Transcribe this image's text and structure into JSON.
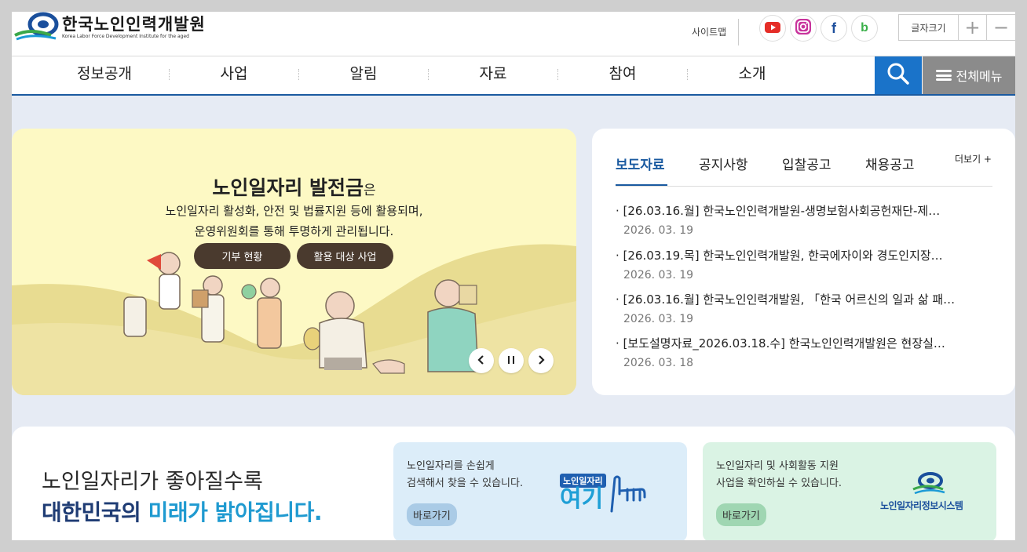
{
  "colors": {
    "primary": "#1a5aa0",
    "search_bg": "#1a73c9",
    "banner_bg": "#fdf9c4",
    "page_bg": "#e6ebf4"
  },
  "header": {
    "logo_title": "한국노인인력개발원",
    "logo_subtitle": "Korea Labor Force Development Institute for the aged",
    "sitemap": "사이트맵",
    "sns": [
      "youtube-icon",
      "instagram-icon",
      "facebook-icon",
      "blog-icon"
    ],
    "fontsize_label": "글자크기",
    "fontsize_plus": "+",
    "fontsize_minus": "−"
  },
  "nav": {
    "items": [
      "정보공개",
      "사업",
      "알림",
      "자료",
      "참여",
      "소개"
    ],
    "allmenu_label": "전체메뉴"
  },
  "banner": {
    "title_bold": "노인일자리 발전금",
    "title_rest": "은",
    "desc_line1": "노인일자리 활성화, 안전 및 법률지원 등에 활용되며,",
    "desc_line2": "운영위원회를 통해 투명하게 관리됩니다.",
    "btn1": "기부 현황",
    "btn2": "활용 대상 사업"
  },
  "news": {
    "tabs": [
      "보도자료",
      "공지사항",
      "입찰공고",
      "채용공고"
    ],
    "more": "더보기 +",
    "items": [
      {
        "title": "· [26.03.16.월] 한국노인인력개발원-생명보험사회공헌재단-제…",
        "date": "2026. 03. 19"
      },
      {
        "title": "· [26.03.19.목] 한국노인인력개발원, 한국에자이와 경도인지장…",
        "date": "2026. 03. 19"
      },
      {
        "title": "· [26.03.16.월] 한국노인인력개발원, 「한국 어르신의 일과 삶 패…",
        "date": "2026. 03. 19"
      },
      {
        "title": "· [보도설명자료_2026.03.18.수] 한국노인인력개발원은 현장실…",
        "date": "2026. 03. 18"
      }
    ]
  },
  "bottom": {
    "slogan_line1": "노인일자리가 좋아질수록",
    "slogan_line2_a": "대한민국의 ",
    "slogan_line2_b": "미래가 밝아집니다.",
    "card1": {
      "line1": "노인일자리를 손쉽게",
      "line2": "검색해서 찾을 수 있습니다.",
      "btn": "바로가기",
      "logo_top": "노인일자리",
      "logo_main": "여기"
    },
    "card2": {
      "line1": "노인일자리 및 사회활동 지원",
      "line2": "사업을 확인하실 수 있습니다.",
      "btn": "바로가기",
      "logo_text": "노인일자리정보시스템"
    }
  }
}
